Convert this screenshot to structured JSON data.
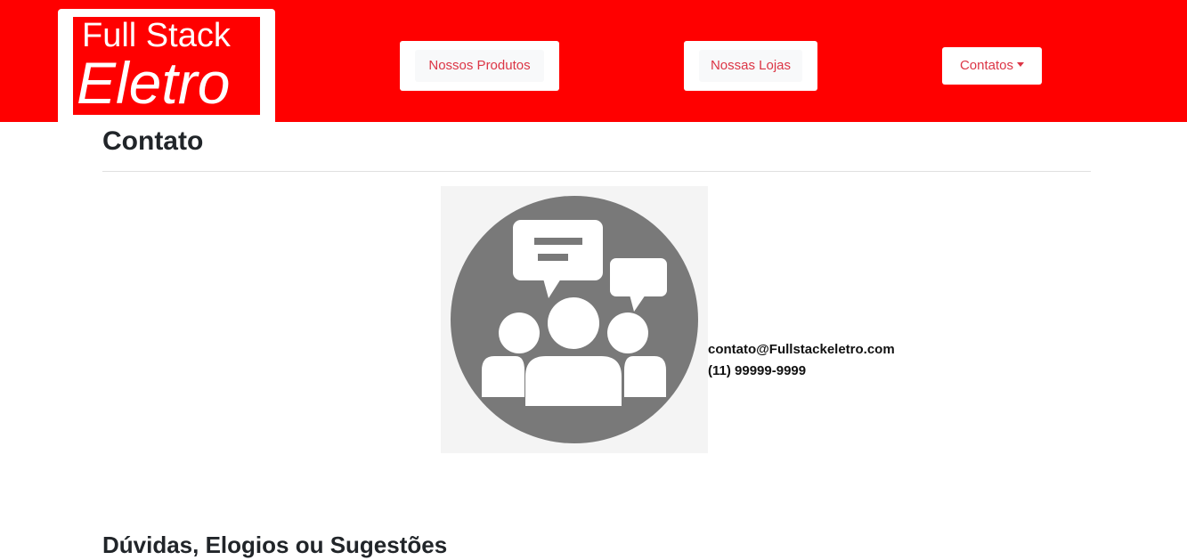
{
  "brand": {
    "line1": "Full Stack",
    "line2": "Eletro",
    "color": "#ff0000"
  },
  "nav": {
    "products_label": "Nossos Produtos",
    "stores_label": "Nossas Lojas",
    "contacts_label": "Contatos",
    "link_color": "#dc3545"
  },
  "main": {
    "title": "Contato",
    "image_icon": "group-chat-icon",
    "email": "contato@Fullstackeletro.com",
    "phone": "(11) 99999-9999",
    "next_section_title": "Dúvidas, Elogios ou Sugestões"
  }
}
